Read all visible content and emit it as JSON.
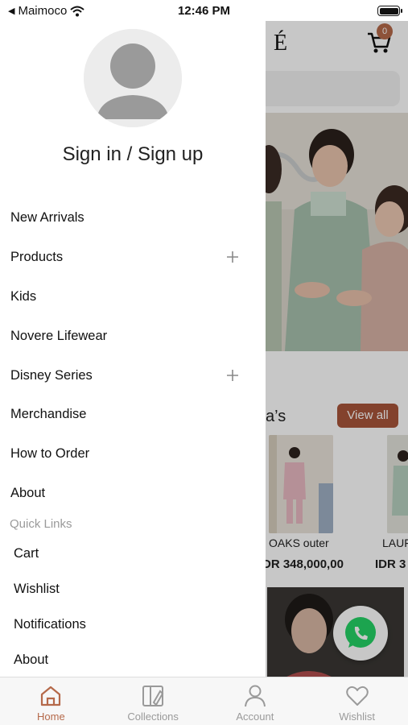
{
  "status_bar": {
    "carrier": "Maimoco",
    "time": "12:46 PM"
  },
  "drawer": {
    "sign_in_label": "Sign in / Sign up",
    "menu": [
      {
        "label": "New Arrivals",
        "expandable": false
      },
      {
        "label": "Products",
        "expandable": true
      },
      {
        "label": "Kids",
        "expandable": false
      },
      {
        "label": "Novere Lifewear",
        "expandable": false
      },
      {
        "label": "Disney Series",
        "expandable": true
      },
      {
        "label": "Merchandise",
        "expandable": false
      },
      {
        "label": "How to Order",
        "expandable": false
      },
      {
        "label": "About",
        "expandable": false
      }
    ],
    "quick_links_label": "Quick Links",
    "quick_links": [
      {
        "label": "Cart"
      },
      {
        "label": "Wishlist"
      },
      {
        "label": "Notifications"
      },
      {
        "label": "About"
      }
    ]
  },
  "background_app": {
    "logo_text": "É",
    "cart_count": "0",
    "section_title": "a’s",
    "view_all_label": "View all",
    "products": [
      {
        "name": "OAKS outer",
        "price": "DR 348,000,00"
      },
      {
        "name": "LAUF",
        "price": "IDR 3"
      }
    ]
  },
  "tab_bar": {
    "tabs": [
      {
        "label": "Home",
        "icon": "home-icon",
        "active": true
      },
      {
        "label": "Collections",
        "icon": "collections-icon",
        "active": false
      },
      {
        "label": "Account",
        "icon": "account-icon",
        "active": false
      },
      {
        "label": "Wishlist",
        "icon": "heart-icon",
        "active": false
      }
    ]
  },
  "colors": {
    "accent": "#b5694a",
    "view_all_button": "#a8553a",
    "whatsapp": "#25d366",
    "inactive_tab": "#9a9a9a"
  }
}
